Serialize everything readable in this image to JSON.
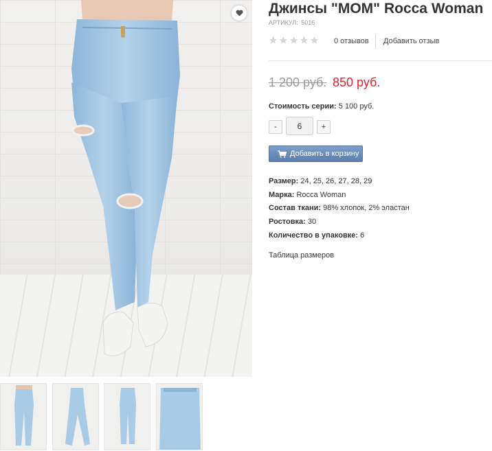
{
  "product": {
    "title": "Джинсы \"MOM\" Rocca Woman",
    "sku_label": "АРТИКУЛ:",
    "sku_value": "5016",
    "rating_stars": 0,
    "rating_max": 5,
    "reviews_count": "0 отзывов",
    "add_review": "Добавить отзыв"
  },
  "price": {
    "old": "1 200 руб.",
    "new": "850 руб."
  },
  "series": {
    "label": "Стоимость серии:",
    "value": "5 100 руб."
  },
  "quantity": {
    "minus": "-",
    "value": "6",
    "plus": "+"
  },
  "cart": {
    "button_label": "Добавить в корзину",
    "icon": "cart-icon"
  },
  "properties": [
    {
      "label": "Размер:",
      "value": "24, 25, 26, 27, 28, 29"
    },
    {
      "label": "Марка:",
      "value": "Rocca Woman"
    },
    {
      "label": "Состав ткани:",
      "value": "98% хлопок, 2% эластан"
    },
    {
      "label": "Ростовка:",
      "value": "30"
    },
    {
      "label": "Количество в упаковке:",
      "value": "6"
    }
  ],
  "size_table_link": "Таблица размеров",
  "gallery": {
    "favorite_icon": "heart-icon",
    "thumbnail_count": 4
  },
  "colors": {
    "price_red": "#e2232a",
    "button_blue": "#6c8dbe",
    "denim": "#a9cbe6"
  }
}
